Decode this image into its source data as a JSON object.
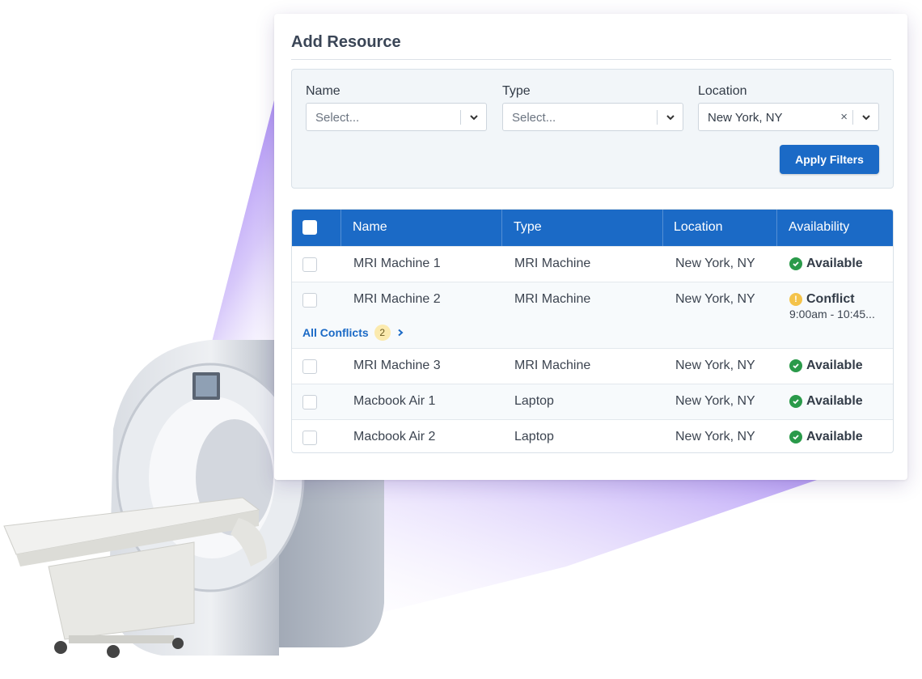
{
  "card": {
    "title": "Add Resource"
  },
  "filters": {
    "name": {
      "label": "Name",
      "placeholder": "Select..."
    },
    "type": {
      "label": "Type",
      "placeholder": "Select..."
    },
    "location": {
      "label": "Location",
      "value": "New York, NY",
      "clear_glyph": "×"
    },
    "apply_label": "Apply Filters"
  },
  "table": {
    "columns": [
      "Name",
      "Type",
      "Location",
      "Availability"
    ],
    "rows": [
      {
        "name": "MRI Machine 1",
        "type": "MRI Machine",
        "location": "New York, NY",
        "status": "Available"
      },
      {
        "name": "MRI Machine 2",
        "type": "MRI Machine",
        "location": "New York, NY",
        "status": "Conflict",
        "status_detail": "9:00am - 10:45...",
        "conflicts_label": "All Conflicts",
        "conflicts_count": "2",
        "warn_glyph": "!"
      },
      {
        "name": "MRI Machine 3",
        "type": "MRI Machine",
        "location": "New York, NY",
        "status": "Available"
      },
      {
        "name": "Macbook Air 1",
        "type": "Laptop",
        "location": "New York, NY",
        "status": "Available"
      },
      {
        "name": "Macbook Air 2",
        "type": "Laptop",
        "location": "New York, NY",
        "status": "Available"
      }
    ]
  },
  "colors": {
    "primary": "#1b6ac6",
    "available": "#2a9a4a",
    "conflict": "#f4c34a",
    "beam": "#8a5cf0"
  },
  "icons": {
    "available": "check-circle-icon",
    "conflict": "warning-circle-icon",
    "dropdown": "chevron-down-icon",
    "expand": "chevron-right-icon"
  }
}
